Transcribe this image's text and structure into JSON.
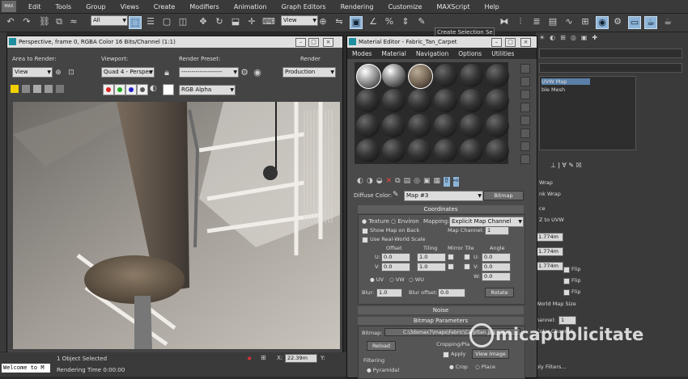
{
  "menu": [
    "Edit",
    "Tools",
    "Group",
    "Views",
    "Create",
    "Modifiers",
    "Animation",
    "Graph Editors",
    "Rendering",
    "Customize",
    "MAXScript",
    "Help"
  ],
  "app_logo": "MAX",
  "toolbar": {
    "filter_value": "All",
    "view_value": "View",
    "selection_set": "Create Selection Se"
  },
  "render_window": {
    "title": "Perspective, frame 0, RGBA Color 16 Bits/Channel (1:1)",
    "area_label": "Area to Render:",
    "area_value": "View",
    "viewport_label": "Viewport:",
    "viewport_value": "Quad 4 - Perspec",
    "preset_label": "Render Preset:",
    "preset_value": "--------------------",
    "render_button": "Render",
    "production_value": "Production",
    "channel_value": "RGB Alpha"
  },
  "status": {
    "selected": "1 Object Selected",
    "render_time": "Rendering Time  0:00:00",
    "welcome": "Welcome to M",
    "x_value": "22.39m"
  },
  "material_editor": {
    "title": "Material Editor - Fabric_Tan_Carpet",
    "menu": [
      "Modes",
      "Material",
      "Navigation",
      "Options",
      "Utilities"
    ],
    "diffuse_label": "Diffuse Color:",
    "map_name": "Map #3",
    "map_type": "Bitmap",
    "coordinates": {
      "header": "Coordinates",
      "texture_label": "Texture",
      "environ_label": "Environ",
      "mapping_label": "Mapping:",
      "mapping_value": "Explicit Map Channel",
      "show_map_back": "Show Map on Back",
      "map_channel_label": "Map Channel:",
      "map_channel_value": "1",
      "real_world": "Use Real-World Scale",
      "offset_label": "Offset",
      "tiling_label": "Tiling",
      "mirror_label": "Mirror Tile",
      "angle_label": "Angle",
      "u_label": "U:",
      "v_label": "V:",
      "w_label": "W:",
      "u_offset": "0.0",
      "v_offset": "0.0",
      "u_tiling": "1.0",
      "v_tiling": "1.0",
      "u_angle": "0.0",
      "v_angle": "0.0",
      "w_angle": "0.0",
      "uv": "UV",
      "vw": "VW",
      "wu": "WU",
      "blur_label": "Blur:",
      "blur_value": "1.0",
      "blur_offset_label": "Blur offset:",
      "blur_offset_value": "0.0",
      "rotate_button": "Rotate"
    },
    "noise_header": "Noise",
    "bitmap_header": "Bitmap Parameters",
    "bitmap_label": "Bitmap:",
    "bitmap_path": "C:\\3dsmax7\\maps\\Fabric\\Carpttan.jpg",
    "reload_button": "Reload",
    "cropping_label": "Cropping/Pla",
    "apply_label": "Apply",
    "view_image_button": "View Image",
    "filtering_label": "Filtering",
    "pyramidal_label": "Pyramidal",
    "crop_label": "Crop",
    "place_label": "Place"
  },
  "command_panel": {
    "items": [
      "UVW Map",
      "ble Mesh"
    ],
    "params": [
      "Wrap",
      "nk Wrap",
      "ce",
      "Z to UVW"
    ],
    "values": [
      "1.774m",
      "1.774m",
      "1.774m"
    ],
    "flip": "Flip",
    "world_map_size": "World Map Size",
    "channel_label": "hannel:",
    "channel_value": "1",
    "color_channel": "Color Channel",
    "filters": "ply Filters..."
  },
  "watermark": "micapublicitate"
}
